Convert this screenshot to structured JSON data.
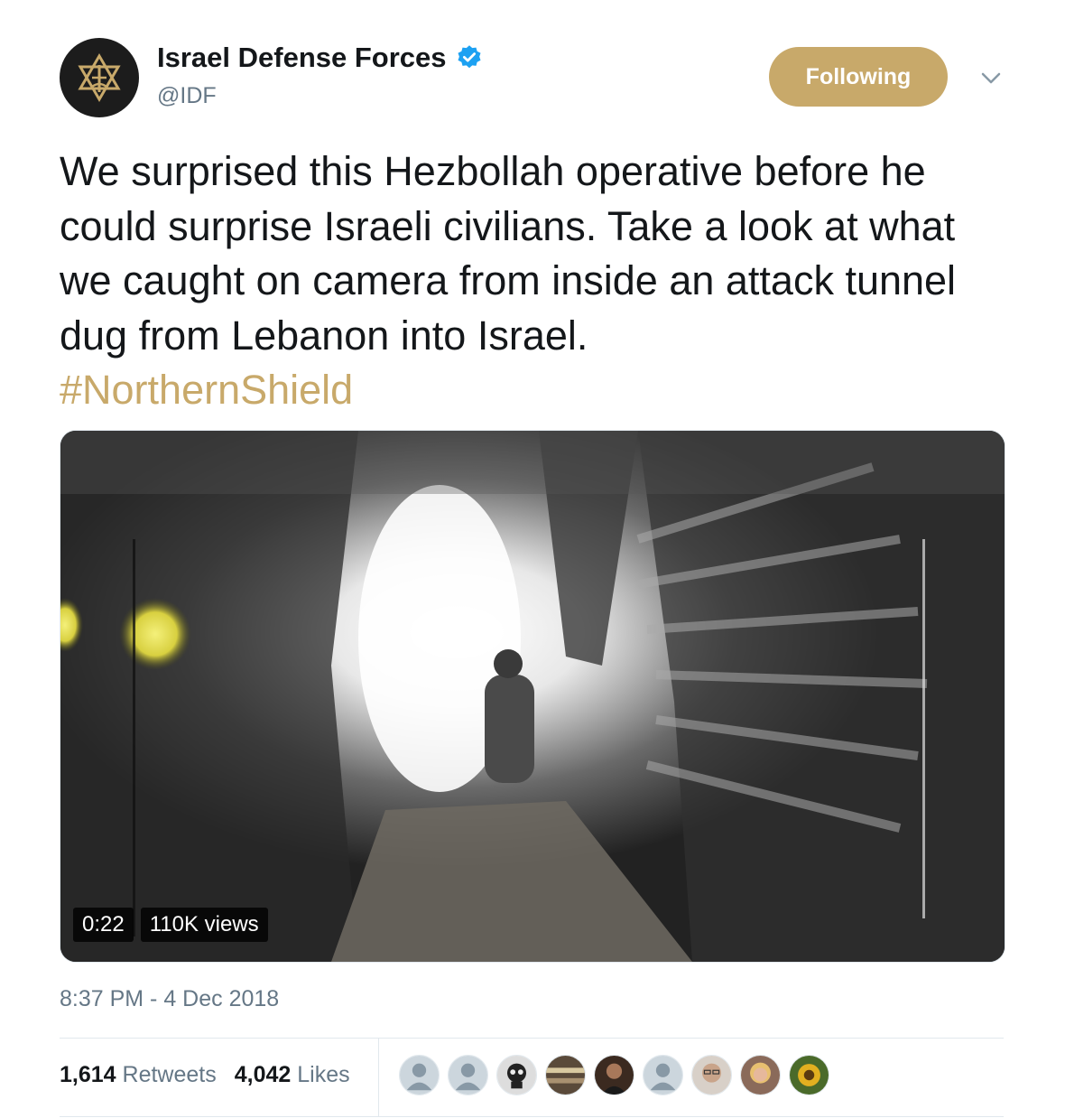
{
  "account": {
    "name": "Israel Defense Forces",
    "handle": "@IDF",
    "avatar_icon": "idf-emblem-icon",
    "verified_icon": "verified-badge-icon"
  },
  "follow_button": {
    "label": "Following",
    "color": "#c8a96a"
  },
  "menu_icon": "chevron-down-icon",
  "tweet": {
    "text": "We surprised this Hezbollah operative before he could surprise Israeli civilians. Take a look at what we caught on camera from inside an attack tunnel dug from Lebanon into Israel.",
    "hashtag": "#NorthernShield"
  },
  "video": {
    "duration": "0:22",
    "views": "110K views"
  },
  "timestamp": "8:37 PM - 4 Dec 2018",
  "stats": {
    "retweets_count": "1,614",
    "retweets_label": "Retweets",
    "likes_count": "4,042",
    "likes_label": "Likes"
  },
  "likers": [
    {
      "kind": "default-avatar-icon",
      "color": "#aab8c2"
    },
    {
      "kind": "default-avatar-icon",
      "color": "#aab8c2"
    },
    {
      "kind": "skull-art-avatar",
      "color": "#444444"
    },
    {
      "kind": "crowd-photo-avatar",
      "color": "#5a4a3a"
    },
    {
      "kind": "man-photo-avatar",
      "color": "#3b2a20"
    },
    {
      "kind": "default-avatar-icon",
      "color": "#aab8c2"
    },
    {
      "kind": "man-glasses-photo-avatar",
      "color": "#c9a48a"
    },
    {
      "kind": "woman-photo-avatar",
      "color": "#d9b38c"
    },
    {
      "kind": "sunflower-photo-avatar",
      "color": "#e2b020"
    }
  ],
  "colors": {
    "accent": "#c8a96a",
    "text": "#14171a",
    "muted": "#657786",
    "verified": "#1da1f2"
  }
}
